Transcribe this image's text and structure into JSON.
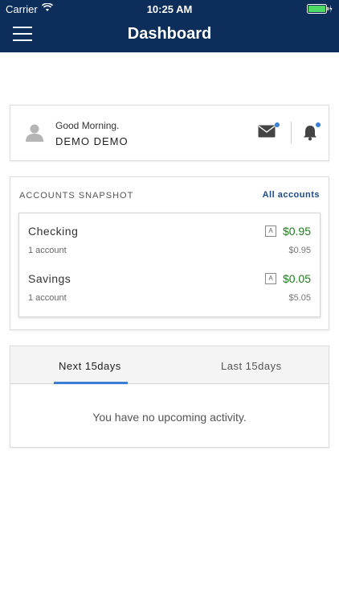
{
  "status_bar": {
    "carrier": "Carrier",
    "time": "10:25 AM",
    "wifi_icon": "wifi-icon",
    "battery_icon": "battery-icon"
  },
  "header": {
    "menu_icon": "hamburger-icon",
    "title": "Dashboard",
    "bg_color": "#0d2d5a"
  },
  "greeting": {
    "avatar_icon": "user-avatar-icon",
    "text": "Good Morning.",
    "user_name": "DEMO DEMO",
    "mail_icon": "mail-icon",
    "bell_icon": "bell-icon",
    "notification_dot_color": "#3b7fd4"
  },
  "snapshot": {
    "label": "ACCOUNTS SNAPSHOT",
    "all_link": "All accounts",
    "accounts": [
      {
        "name": "Checking",
        "count": "1 account",
        "badge": "A",
        "balance": "$0.95",
        "total": "$0.95"
      },
      {
        "name": "Savings",
        "count": "1 account",
        "badge": "A",
        "balance": "$0.05",
        "total": "$5.05"
      }
    ],
    "balance_color": "#1a7f1a"
  },
  "activity": {
    "tabs": [
      {
        "label": "Next 15days",
        "active": true
      },
      {
        "label": "Last 15days",
        "active": false
      }
    ],
    "empty_message": "You have no upcoming activity.",
    "accent_color": "#3b7fd4"
  }
}
